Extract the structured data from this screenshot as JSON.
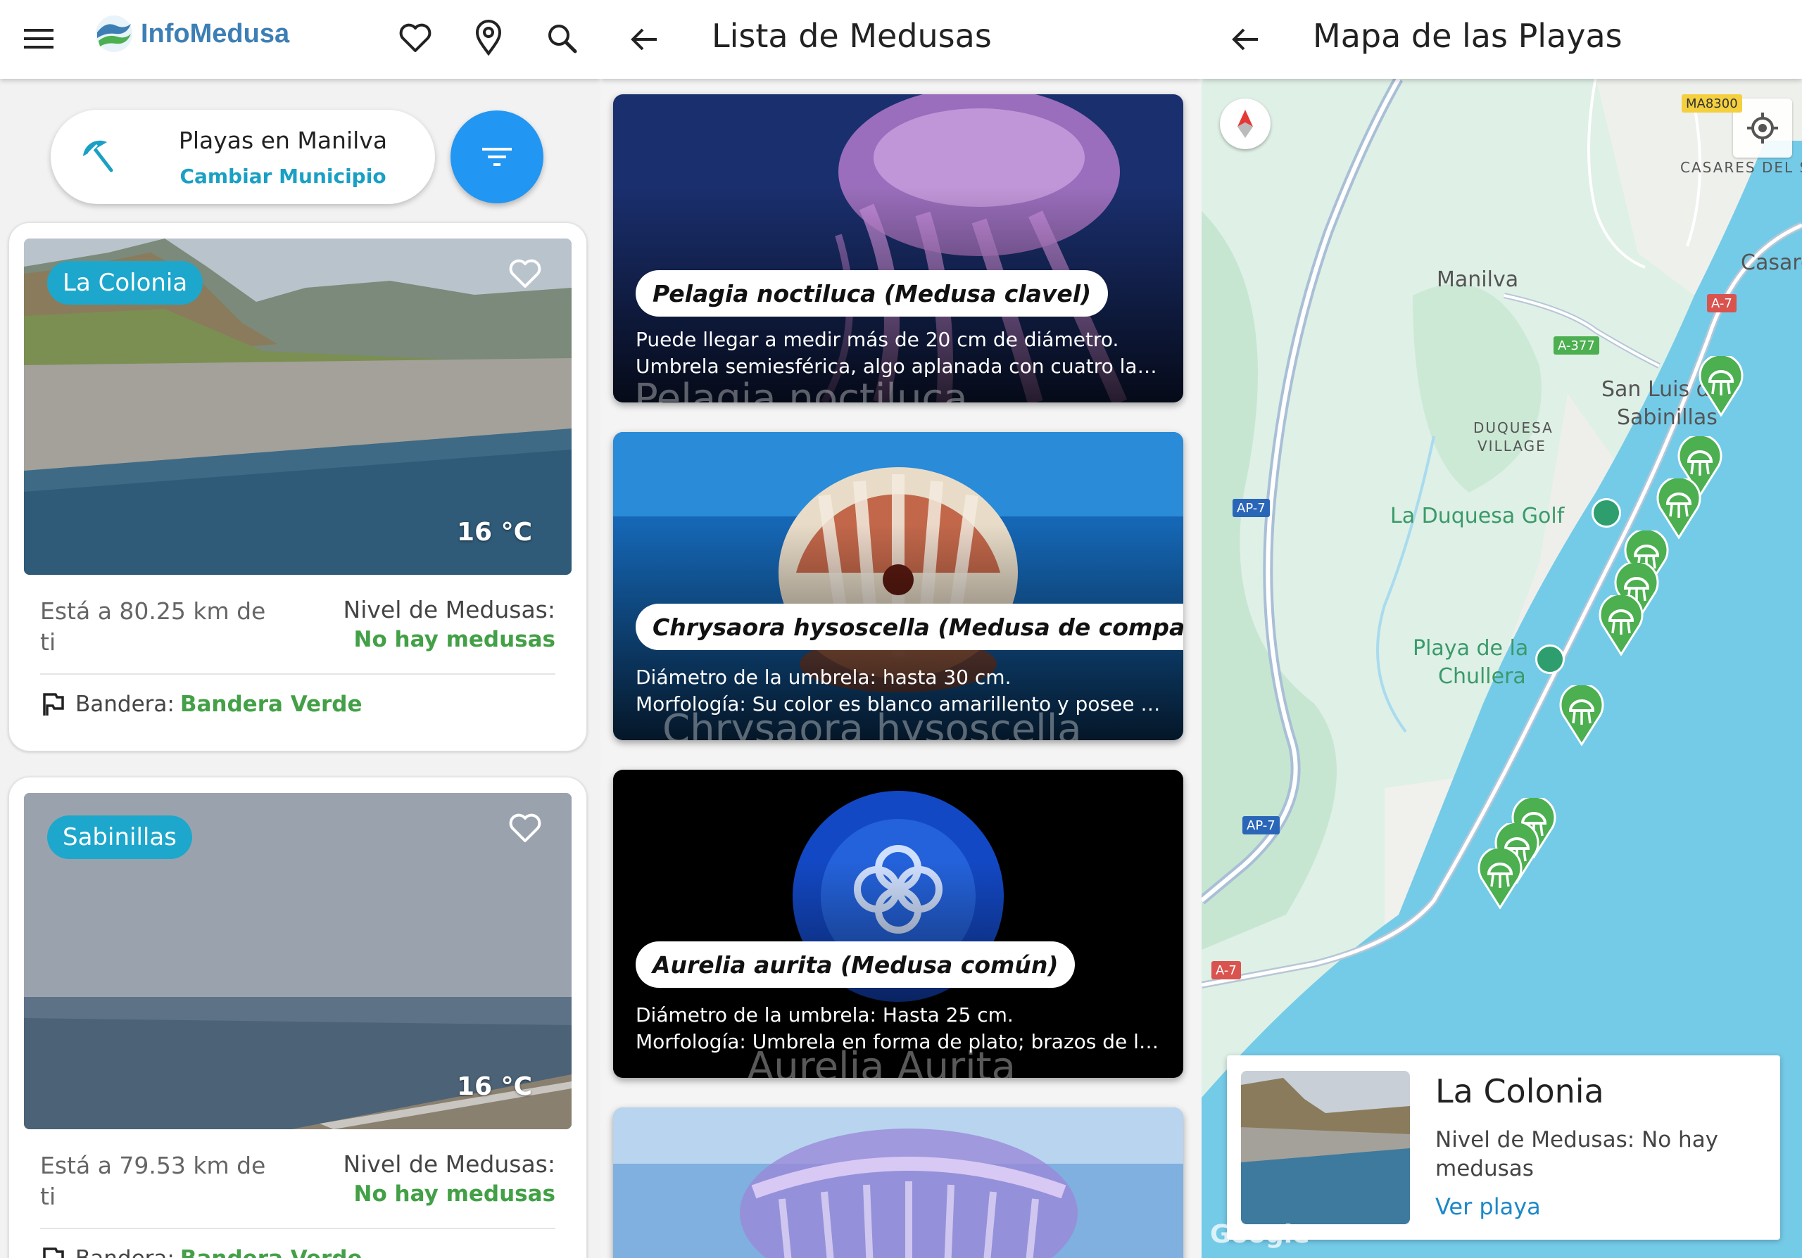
{
  "screen1": {
    "brand": "InfoMedusa",
    "municipality": {
      "title": "Playas en Manilva",
      "change_label": "Cambiar Municipio"
    },
    "beaches": [
      {
        "name": "La Colonia",
        "temp": "16 °C",
        "distance": "Está a 80.25 km de ti",
        "level_label": "Nivel de Medusas:",
        "level_value": "No hay medusas",
        "flag_label": "Bandera:",
        "flag_value": "Bandera Verde"
      },
      {
        "name": "Sabinillas",
        "temp": "16 °C",
        "distance": "Está a 79.53 km de ti",
        "level_label": "Nivel de Medusas:",
        "level_value": "No hay medusas",
        "flag_label": "Bandera:",
        "flag_value": "Bandera Verde"
      }
    ]
  },
  "screen2": {
    "title": "Lista de Medusas",
    "jellyfish": [
      {
        "name": "Pelagia noctiluca (Medusa clavel)",
        "line1": "Puede llegar a medir más de 20 cm de diámetro.",
        "line2": "Umbrela semiesférica, algo aplanada con cuatro largos...",
        "watermark": "Pelagia noctiluca"
      },
      {
        "name": "Chrysaora hysoscella (Medusa de compases)",
        "line1": "Diámetro de la umbrela: hasta 30 cm.",
        "line2": "Morfología: Su color es blanco amarillento y posee un ...",
        "watermark": "Chrysaora hysoscella"
      },
      {
        "name": "Aurelia aurita (Medusa común)",
        "line1": "Diámetro de la umbrela: Hasta 25 cm.",
        "line2": "Morfología: Umbrela en forma de plato; brazos de la ...",
        "watermark": "Aurelia Aurita"
      }
    ]
  },
  "screen3": {
    "title": "Mapa de las Playas",
    "labels": {
      "manilva": "Manilva",
      "san_luis_1": "San Luis de",
      "san_luis_2": "Sabinillas",
      "duquesa_1": "DUQUESA",
      "duquesa_2": "VILLAGE",
      "duquesa_golf": "La Duquesa Golf",
      "chullera_1": "Playa de la",
      "chullera_2": "Chullera",
      "casares_del_sol": "CASARES DEL S",
      "casares": "Casare"
    },
    "roads": {
      "ma8300": "MA8300",
      "a7": "A-7",
      "a377": "A-377",
      "ap7": "AP-7"
    },
    "info_card": {
      "title": "La Colonia",
      "level": "Nivel de Medusas: No hay medusas",
      "link": "Ver playa"
    },
    "attribution": "Google"
  },
  "colors": {
    "accent": "#2196f3",
    "chip": "#1ea7cc",
    "green": "#43a047",
    "sea": "#74cbe8",
    "marker": "#4caf50"
  }
}
